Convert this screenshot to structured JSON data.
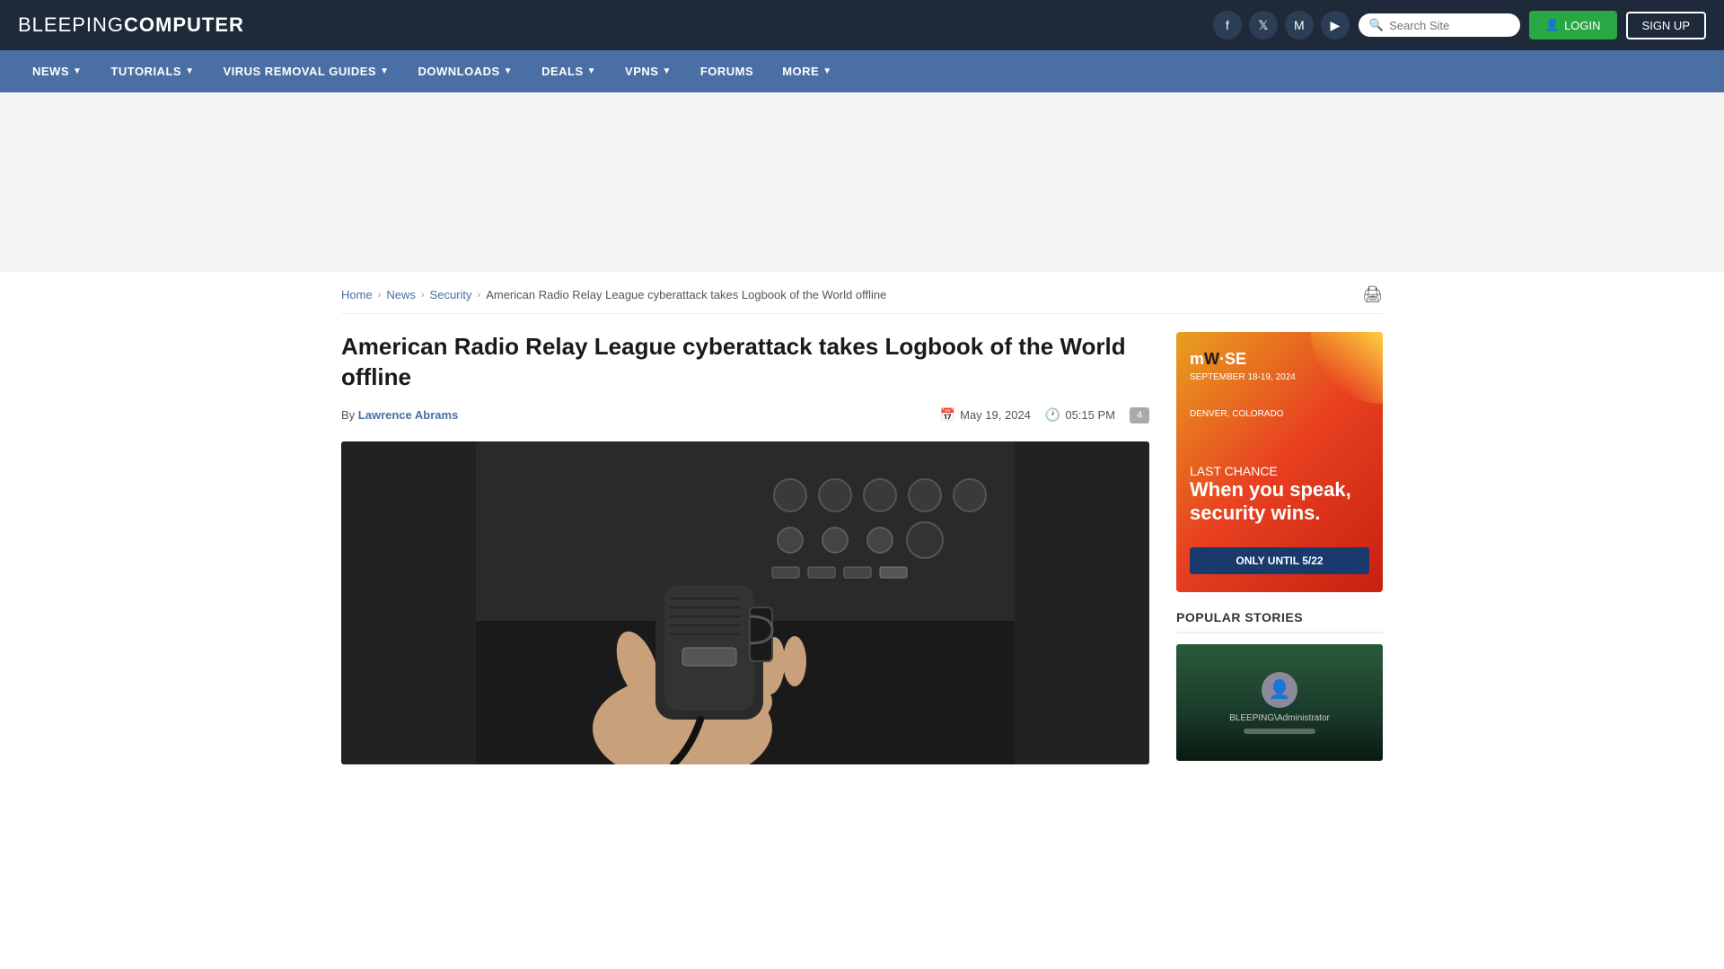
{
  "site": {
    "logo_light": "BLEEPING",
    "logo_bold": "COMPUTER",
    "title": "BleepingComputer"
  },
  "header": {
    "search_placeholder": "Search Site",
    "login_label": "LOGIN",
    "signup_label": "SIGN UP",
    "social": [
      {
        "name": "facebook",
        "symbol": "f"
      },
      {
        "name": "twitter",
        "symbol": "𝕏"
      },
      {
        "name": "mastodon",
        "symbol": "M"
      },
      {
        "name": "youtube",
        "symbol": "▶"
      }
    ]
  },
  "nav": {
    "items": [
      {
        "label": "NEWS",
        "has_dropdown": true
      },
      {
        "label": "TUTORIALS",
        "has_dropdown": true
      },
      {
        "label": "VIRUS REMOVAL GUIDES",
        "has_dropdown": true
      },
      {
        "label": "DOWNLOADS",
        "has_dropdown": true
      },
      {
        "label": "DEALS",
        "has_dropdown": true
      },
      {
        "label": "VPNS",
        "has_dropdown": true
      },
      {
        "label": "FORUMS",
        "has_dropdown": false
      },
      {
        "label": "MORE",
        "has_dropdown": true
      }
    ]
  },
  "breadcrumb": {
    "home": "Home",
    "news": "News",
    "security": "Security",
    "current": "American Radio Relay League cyberattack takes Logbook of the World offline"
  },
  "article": {
    "title": "American Radio Relay League cyberattack takes Logbook of the World offline",
    "author": "Lawrence Abrams",
    "date": "May 19, 2024",
    "time": "05:15 PM",
    "comment_count": "4"
  },
  "sidebar": {
    "ad": {
      "logo": "mW·SE",
      "event_date": "SEPTEMBER 18-19, 2024",
      "event_location": "DENVER, COLORADO",
      "headline1": "LAST CHANCE",
      "headline2": "When you speak, security wins.",
      "cta": "ONLY UNTIL 5/22"
    },
    "popular_stories_label": "POPULAR STORIES",
    "popular_story_login_text": "BLEEPING\\Administrator"
  }
}
